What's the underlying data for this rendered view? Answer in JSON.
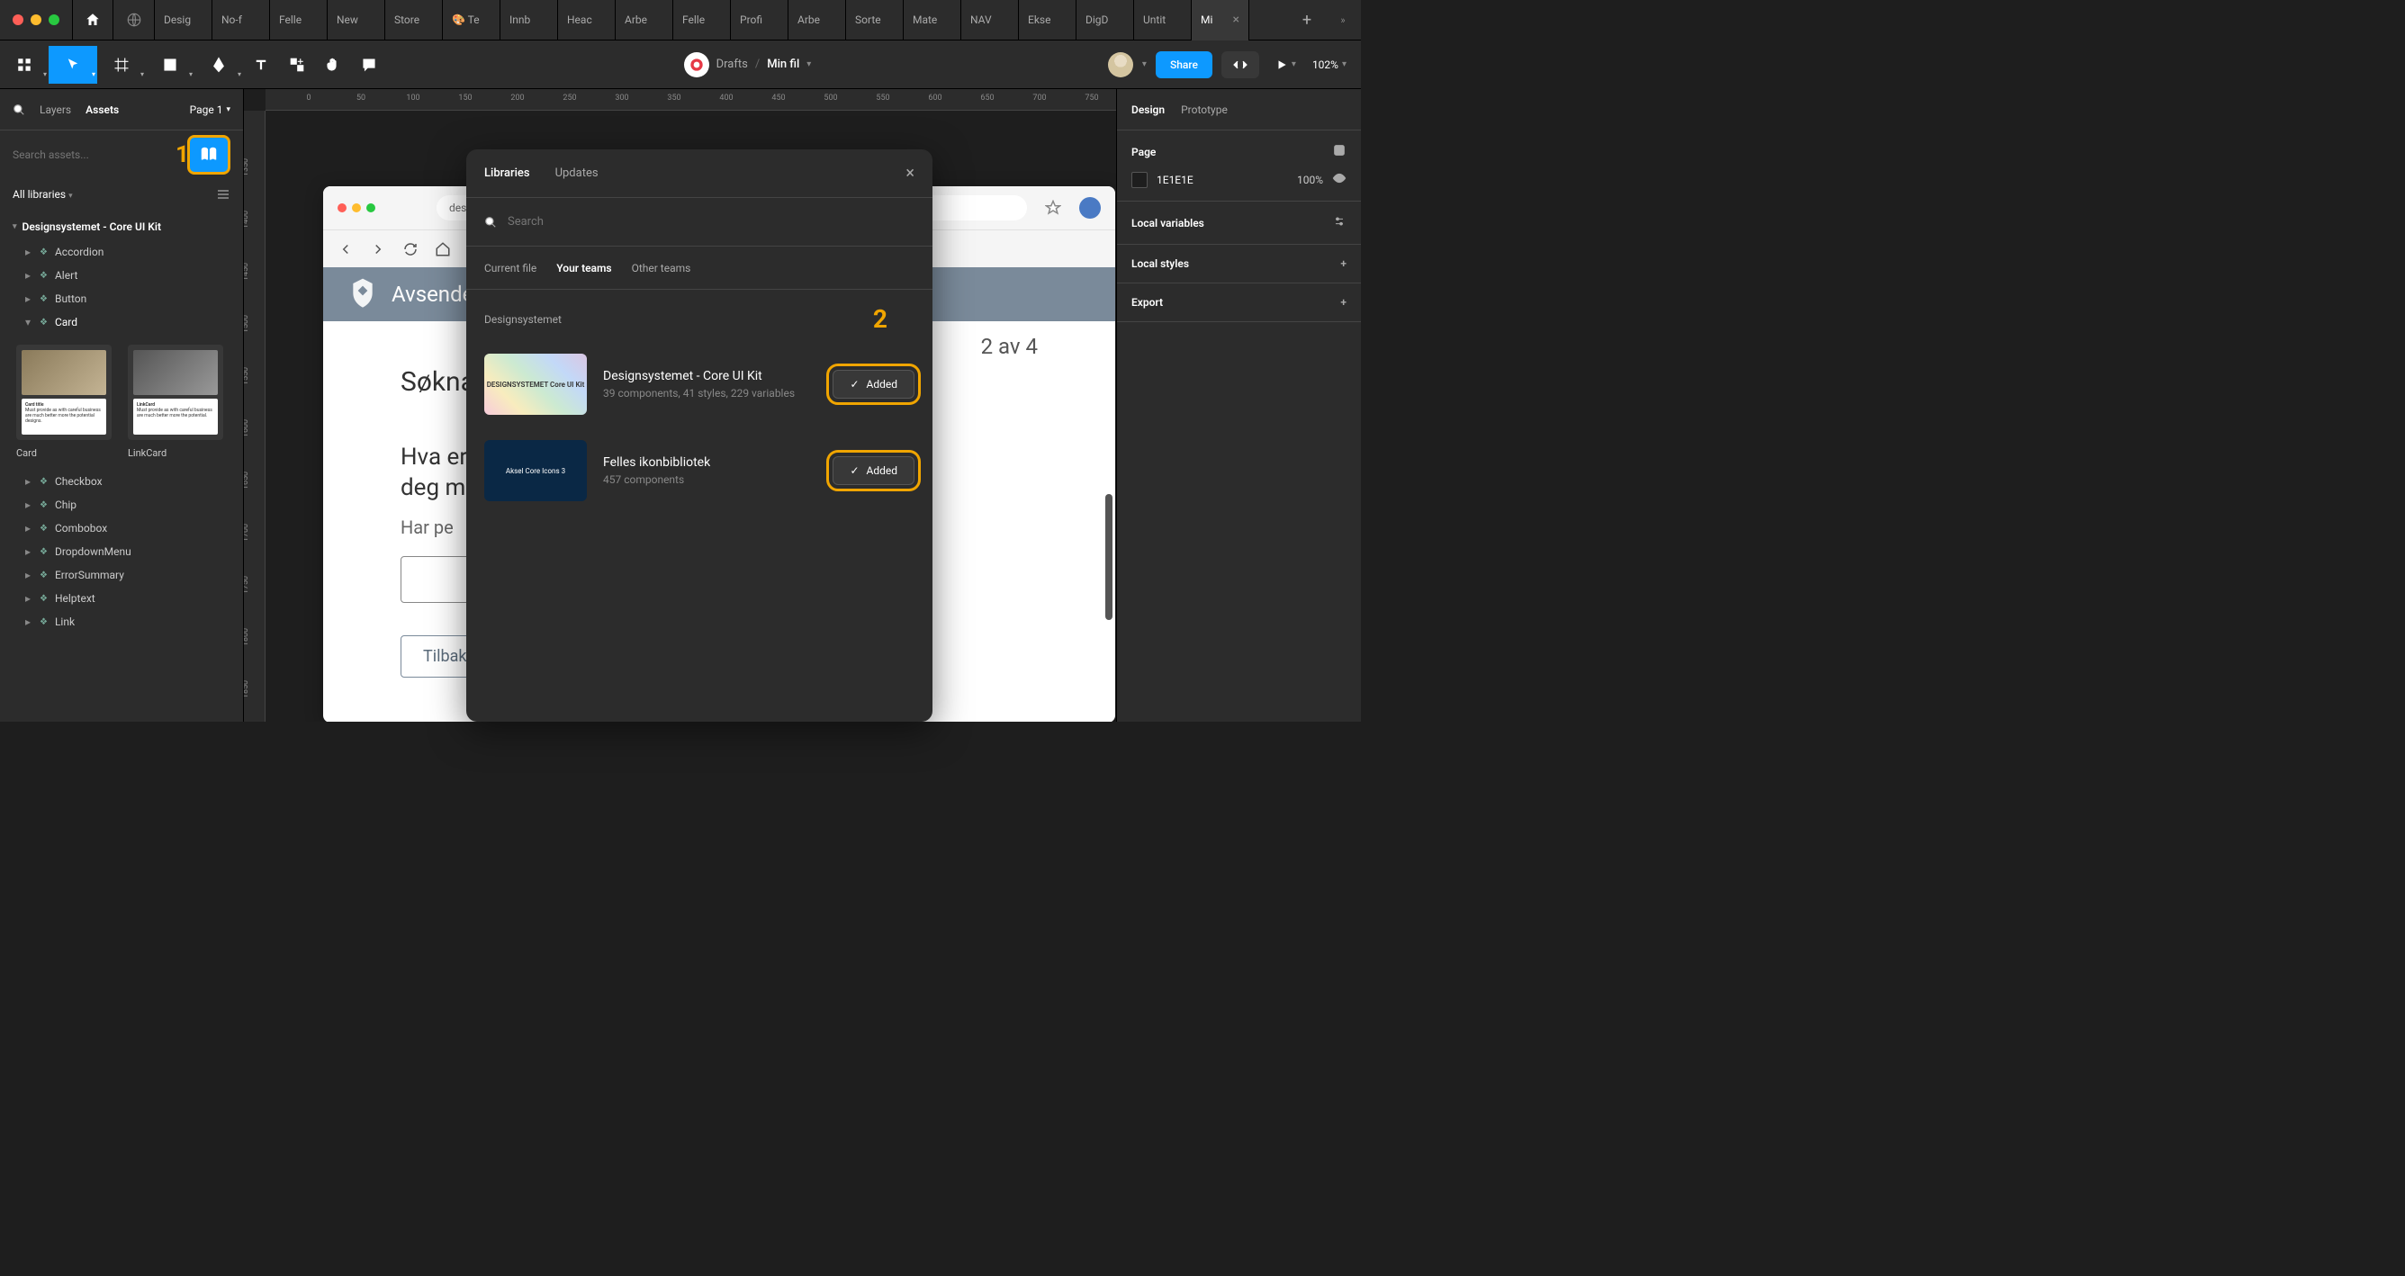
{
  "tabs": [
    "Desig",
    "No-f",
    "Felle",
    "New",
    "Store",
    "🎨 Te",
    "Innb",
    "Heac",
    "Arbe",
    "Felle",
    "Profi",
    "Arbe",
    "Sorte",
    "Mate",
    "NAV",
    "Ekse",
    "DigD",
    "Untit",
    "Mi"
  ],
  "toolbar": {
    "breadcrumb": "Drafts",
    "filename": "Min fil",
    "share": "Share",
    "zoom": "102%"
  },
  "leftPanel": {
    "tabLayers": "Layers",
    "tabAssets": "Assets",
    "pageLabel": "Page 1",
    "searchPlaceholder": "Search assets...",
    "libSelector": "All libraries",
    "annotation1": "1",
    "treeHeader": "Designsystemet - Core UI Kit",
    "items": [
      "Accordion",
      "Alert",
      "Button",
      "Card",
      "Checkbox",
      "Chip",
      "Combobox",
      "DropdownMenu",
      "ErrorSummary",
      "Helptext",
      "Link"
    ],
    "cardPreview1": "Card",
    "cardPreview1Title": "Card title",
    "cardPreview2": "LinkCard",
    "cardPreview2Title": "LinkCard"
  },
  "canvas": {
    "rulerH": [
      "0",
      "50",
      "100",
      "150",
      "200",
      "250",
      "300",
      "350",
      "400",
      "450",
      "500",
      "550",
      "600",
      "650",
      "700",
      "750"
    ],
    "rulerV": [
      "1350",
      "1400",
      "1450",
      "1500",
      "1550",
      "1600",
      "1650",
      "1700",
      "1750",
      "1800",
      "1850"
    ],
    "frame": {
      "url": "desig",
      "headerTitle": "Avsender",
      "h1": "Søknad",
      "step": "2 av 4",
      "h2a": "Hva er",
      "h2b": "deg m",
      "p": "Har pe",
      "back": "Tilbak"
    }
  },
  "modal": {
    "tabLibraries": "Libraries",
    "tabUpdates": "Updates",
    "searchPlaceholder": "Search",
    "filterCurrent": "Current file",
    "filterYour": "Your teams",
    "filterOther": "Other teams",
    "sectionHeader": "Designsystemet",
    "annotation2": "2",
    "lib1": {
      "name": "Designsystemet - Core UI Kit",
      "meta": "39 components, 41 styles, 229 variables",
      "thumbLabel": "DESIGNSYSTEMET Core UI Kit",
      "btn": "Added"
    },
    "lib2": {
      "name": "Felles ikonbibliotek",
      "meta": "457 components",
      "thumbLabel": "Aksel Core Icons 3",
      "btn": "Added"
    }
  },
  "rightPanel": {
    "tabDesign": "Design",
    "tabPrototype": "Prototype",
    "sectionPage": "Page",
    "colorHex": "1E1E1E",
    "colorOpacity": "100%",
    "sectionLocalVars": "Local variables",
    "sectionLocalStyles": "Local styles",
    "sectionExport": "Export"
  }
}
